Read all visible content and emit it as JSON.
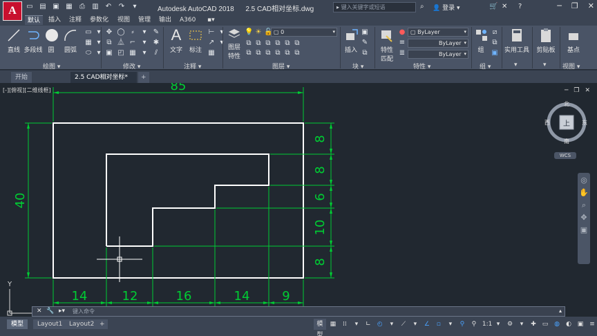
{
  "titlebar": {
    "logo": "A",
    "app_name": "Autodesk AutoCAD 2018",
    "file_name": "2.5 CAD相对坐标.dwg",
    "search_placeholder": "键入关键字或短语",
    "login": "登录"
  },
  "ribbon_tabs": [
    "默认",
    "插入",
    "注释",
    "参数化",
    "视图",
    "管理",
    "输出",
    "A360"
  ],
  "ribbon_active_tab": "默认",
  "ribbon": {
    "draw_panel": {
      "title": "绘图",
      "line": "直线",
      "polyline": "多段线",
      "circle": "圆",
      "arc": "圆弧"
    },
    "modify_panel": {
      "title": "修改"
    },
    "annotation_panel": {
      "title": "注释",
      "text": "文字",
      "dimension": "标注"
    },
    "layers_panel": {
      "title": "图层",
      "layer_props": "图层",
      "layer_props2": "特性",
      "current_layer": "0"
    },
    "block_panel": {
      "title": "块",
      "insert": "插入"
    },
    "properties_panel": {
      "title": "特性",
      "match": "特性",
      "match2": "匹配",
      "color": "ByLayer",
      "linetype": "ByLayer",
      "lineweight": "ByLayer"
    },
    "groups_panel": {
      "title": "组",
      "group": "组"
    },
    "utilities_panel": {
      "title": "",
      "label": "实用工具"
    },
    "clipboard_panel": {
      "title": "",
      "label": "剪贴板"
    },
    "view_panel": {
      "title": "视图",
      "label": "基点"
    }
  },
  "doc_tabs": {
    "start": "开始",
    "active": "2.5 CAD相对坐标*"
  },
  "viewport": {
    "label": "[-][俯视][二维线框]"
  },
  "viewcube": {
    "north": "北",
    "south": "南",
    "east": "东",
    "west": "西",
    "top": "上",
    "wcs": "WCS"
  },
  "dimensions": {
    "top": "85",
    "left": "40",
    "bottom": [
      "14",
      "12",
      "16",
      "14",
      "9"
    ],
    "right": [
      "8",
      "8",
      "6",
      "10",
      "8"
    ]
  },
  "ucs": {
    "y": "Y",
    "x": "X"
  },
  "command": {
    "placeholder": "键入命令"
  },
  "layout_tabs": [
    "模型",
    "Layout1",
    "Layout2"
  ],
  "status": {
    "model": "模型",
    "scale": "1:1"
  }
}
